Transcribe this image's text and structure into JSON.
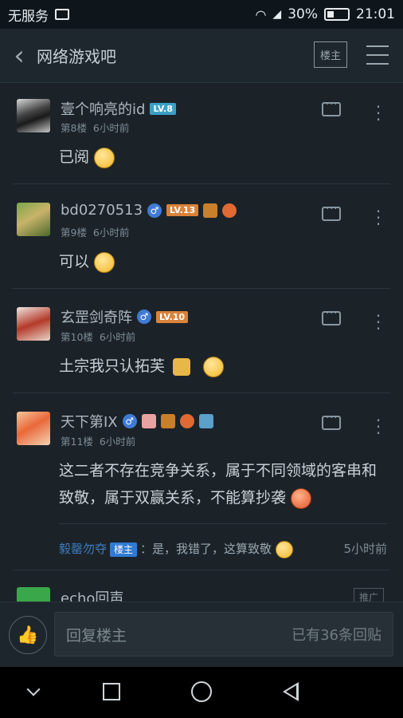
{
  "status_bar": {
    "carrier": "无服务",
    "battery": "30%",
    "time": "21:01"
  },
  "header": {
    "title": "网络游戏吧",
    "louzhu_button": "楼主"
  },
  "posts": [
    {
      "username": "壹个响亮的id",
      "level": "LV.8",
      "floor": "第8楼",
      "time": "6小时前",
      "content": "已阅"
    },
    {
      "username": "bd0270513",
      "level": "LV.13",
      "floor": "第9楼",
      "time": "6小时前",
      "content": "可以"
    },
    {
      "username": "玄罡剑奇阵",
      "level": "LV.10",
      "floor": "第10楼",
      "time": "6小时前",
      "content": "土宗我只认拓芙"
    },
    {
      "username": "天下第IX",
      "floor": "第11楼",
      "time": "6小时前",
      "content": "这二者不存在竞争关系，属于不同领域的客串和致敬，属于双赢关系，不能算抄袭",
      "sub_reply": {
        "username": "毅罄勿夺",
        "badge": "楼主",
        "text": "：是，我错了，这算致敬",
        "time": "5小时前"
      }
    },
    {
      "username": "echo回声",
      "tag": "推广"
    }
  ],
  "bottom_bar": {
    "reply_placeholder": "回复楼主",
    "reply_count": "已有36条回贴"
  },
  "colors": {
    "background": "#1b2329",
    "link": "#3e7cc1",
    "level_blue": "#3aa0c8",
    "level_orange": "#d9823a"
  }
}
